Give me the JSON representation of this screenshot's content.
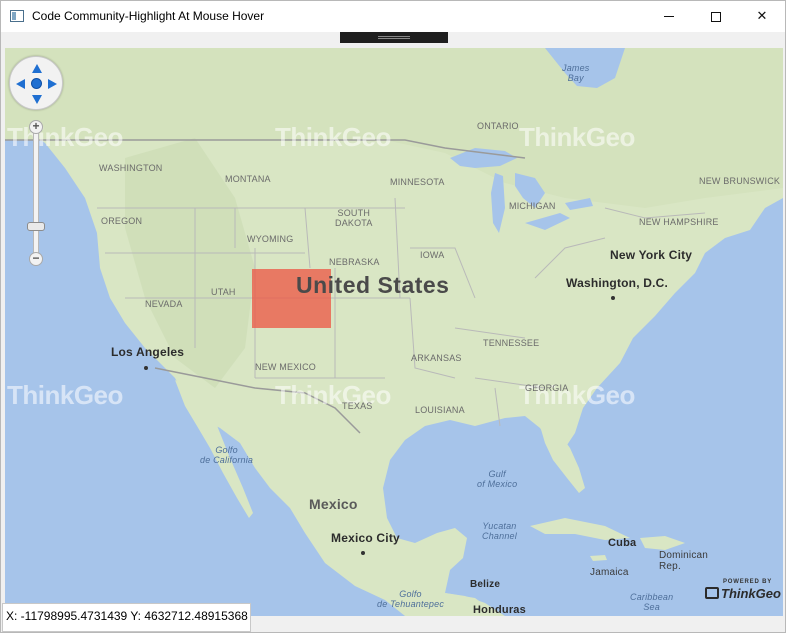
{
  "window": {
    "title": "Code Community-Highlight At Mouse Hover",
    "minimize_icon": "minimize-icon",
    "maximize_icon": "maximize-icon",
    "close_glyph": "✕"
  },
  "map": {
    "big_label": "United States",
    "countries": {
      "mexico": "Mexico"
    },
    "states": {
      "washington": "WASHINGTON",
      "oregon": "OREGON",
      "montana": "MONTANA",
      "wyoming": "WYOMING",
      "utah": "UTAH",
      "nevada": "NEVADA",
      "new_mexico": "NEW MEXICO",
      "texas": "TEXAS",
      "nebraska": "NEBRASKA",
      "south_dakota": "SOUTH\nDAKOTA",
      "minnesota": "MINNESOTA",
      "iowa": "IOWA",
      "arkansas": "ARKANSAS",
      "louisiana": "LOUISIANA",
      "tennessee": "TENNESSEE",
      "georgia": "GEORGIA",
      "michigan": "MICHIGAN",
      "ontario": "ONTARIO",
      "new_brunswick": "NEW BRUNSWICK",
      "new_hampshire": "NEW HAMPSHIRE"
    },
    "cities": {
      "los_angeles": "Los Angeles",
      "new_york": "New York City",
      "washington_dc": "Washington, D.C.",
      "mexico_city": "Mexico City",
      "cuba": "Cuba",
      "dominican": "Dominican\nRep.",
      "jamaica": "Jamaica",
      "belize": "Belize",
      "honduras": "Honduras"
    },
    "water": {
      "james_bay": "James\nBay",
      "golfo_california": "Golfo\nde California",
      "gulf_mexico": "Gulf\nof Mexico",
      "yucatan": "Yucatan\nChannel",
      "caribbean": "Caribbean\nSea",
      "golfo_tehuantepec": "Golfo\nde Tehuantepec"
    },
    "watermark_text": "ThinkGeo",
    "powered_by": "POWERED BY",
    "powered_logo": "ThinkGeo",
    "highlight_color": "#ec5a48"
  },
  "controls": {
    "pan_icon": "pan-compass-icon",
    "zoom_in_glyph": "+",
    "zoom_out_glyph": "−",
    "zoom_level": 0.25
  },
  "status": {
    "coordinates": "X: -11798995.4731439  Y: 4632712.48915368"
  }
}
